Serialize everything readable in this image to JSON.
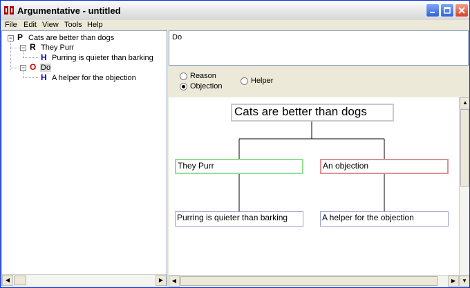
{
  "window": {
    "title": "Argumentative - untitled"
  },
  "menu": [
    "File",
    "Edit",
    "View",
    "Tools",
    "Help"
  ],
  "tree": {
    "premise": {
      "tag": "P",
      "label": "Cats are better than dogs"
    },
    "reason": {
      "tag": "R",
      "label": "They Purr"
    },
    "reason_helper": {
      "tag": "H",
      "label": "Purring is quieter than barking"
    },
    "objection": {
      "tag": "O",
      "label": "Do"
    },
    "objection_helper": {
      "tag": "H",
      "label": "A helper for the objection"
    }
  },
  "editor": {
    "text": "Do"
  },
  "node_type": {
    "options": [
      "Reason",
      "Objection",
      "Helper"
    ],
    "selected": "Objection"
  },
  "diagram": {
    "premise": "Cats are better than dogs",
    "reason": "They Purr",
    "objection": "An objection",
    "reason_helper": "Purring is quieter than barking",
    "objection_helper": "A helper for the objection"
  },
  "colors": {
    "reason_border": "#90e090",
    "objection_border": "#e09090",
    "helper_border": "#9aa0d8",
    "objection_tag": "#d40000",
    "helper_tag": "#0000c8"
  },
  "icons": {
    "app": "argumentative-app-icon",
    "minimize": "minimize-icon",
    "maximize": "maximize-icon",
    "close": "close-icon"
  }
}
